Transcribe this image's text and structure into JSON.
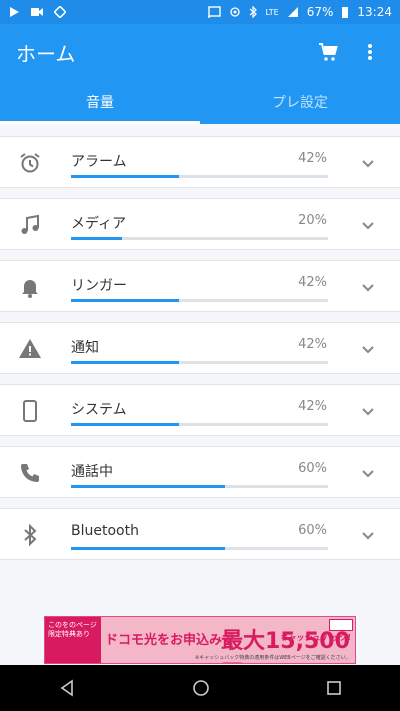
{
  "status": {
    "battery": "67%",
    "time": "13:24",
    "network": "LTE"
  },
  "appbar": {
    "title": "ホーム"
  },
  "tabs": [
    {
      "label": "音量"
    },
    {
      "label": "プレ設定"
    }
  ],
  "items": [
    {
      "label": "アラーム",
      "percent_text": "42%",
      "percent": 42,
      "icon": "alarm-icon"
    },
    {
      "label": "メディア",
      "percent_text": "20%",
      "percent": 20,
      "icon": "music-note-icon"
    },
    {
      "label": "リンガー",
      "percent_text": "42%",
      "percent": 42,
      "icon": "bell-icon"
    },
    {
      "label": "通知",
      "percent_text": "42%",
      "percent": 42,
      "icon": "warning-icon"
    },
    {
      "label": "システム",
      "percent_text": "42%",
      "percent": 42,
      "icon": "phone-device-icon"
    },
    {
      "label": "通話中",
      "percent_text": "60%",
      "percent": 60,
      "icon": "call-icon"
    },
    {
      "label": "Bluetooth",
      "percent_text": "60%",
      "percent": 60,
      "icon": "bluetooth-icon"
    }
  ],
  "ad": {
    "left_text": "このをのページ 限定特典あり",
    "main_text": "ドコモ光をお申込みで",
    "big_text": "最大15,500円",
    "side_text": "キャッシュ バック!",
    "small_text": "※キャッシュバック特典の適用条件はWEBページをご確認ください。"
  },
  "colors": {
    "primary": "#2196f3",
    "track": "#dde2e7"
  }
}
